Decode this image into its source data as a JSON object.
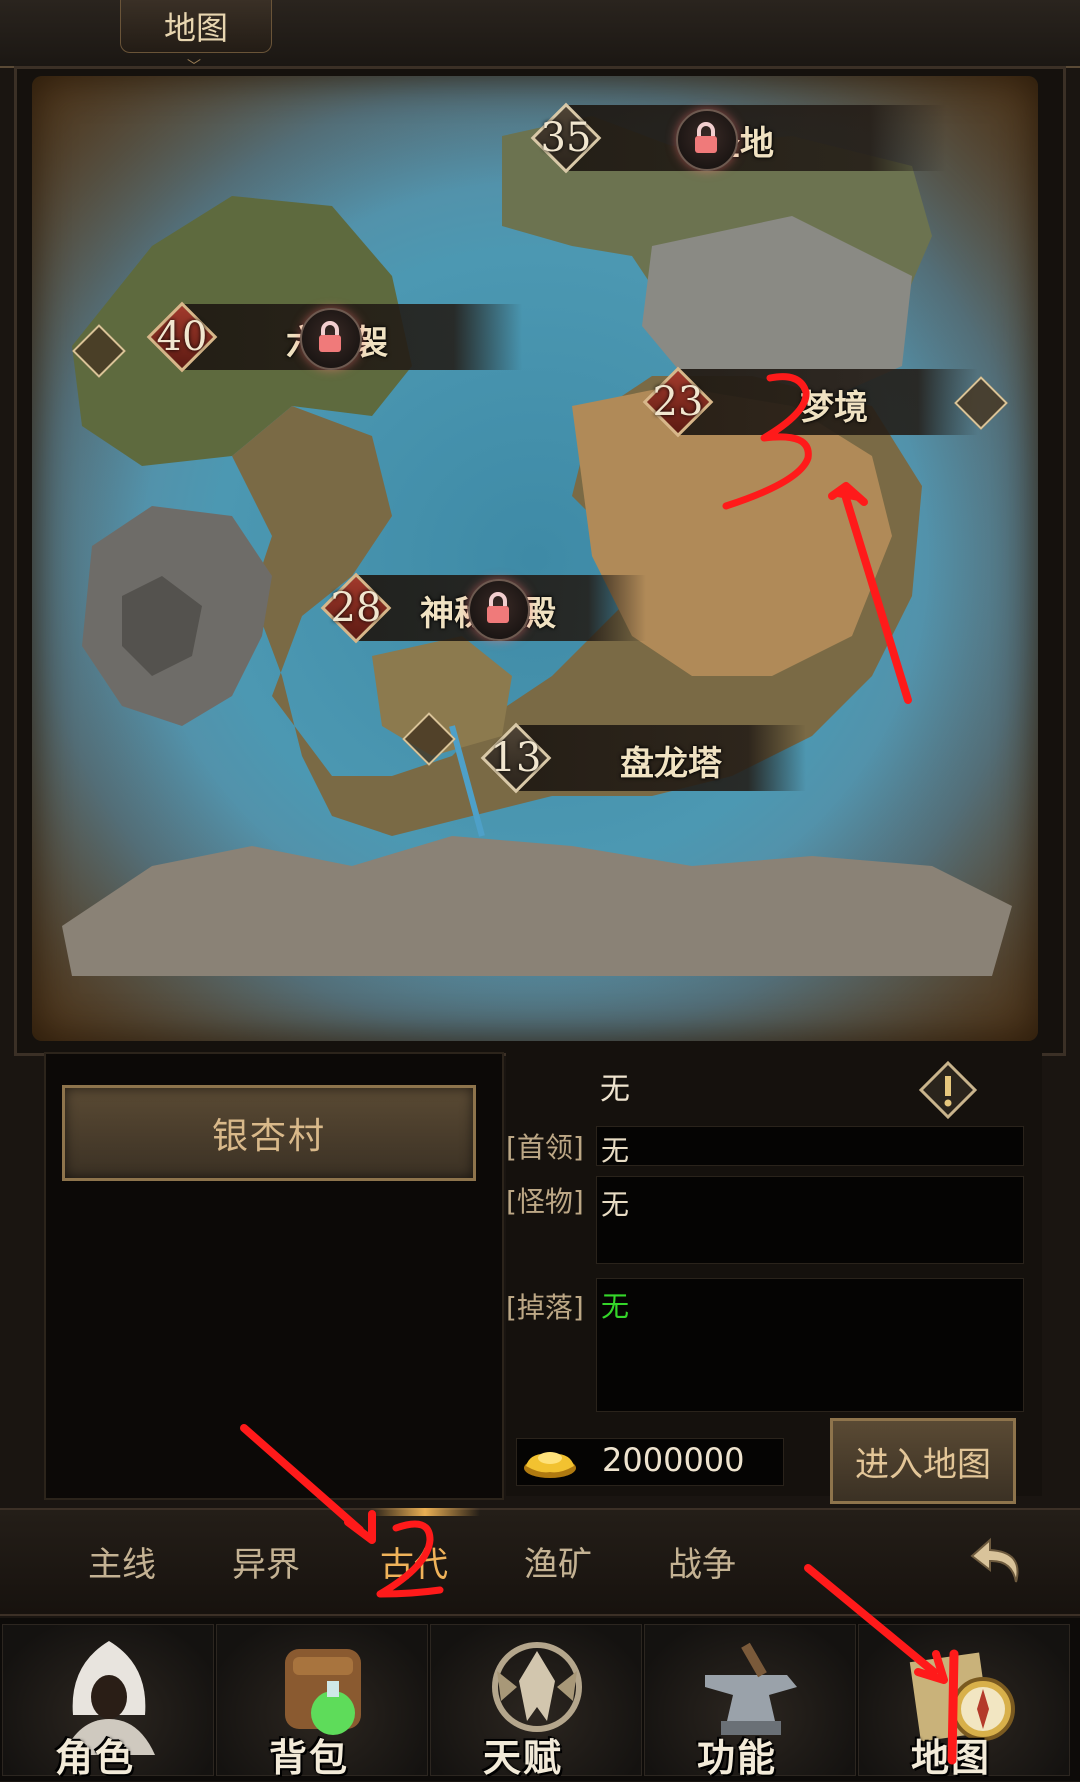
{
  "title": {
    "label": "地图"
  },
  "map": {
    "nodes": [
      {
        "level": "35",
        "name": "圣地",
        "locked": true
      },
      {
        "level": "40",
        "name": "六道袈",
        "locked": true
      },
      {
        "level": "23",
        "name": "梦境",
        "locked": false
      },
      {
        "level": "28",
        "name": "神秘暗殿",
        "locked": true
      },
      {
        "level": "13",
        "name": "盘龙塔",
        "locked": false
      }
    ]
  },
  "panel": {
    "selected_village": "银杏村",
    "map_name": "无",
    "fields": [
      {
        "label": "[首领]",
        "value": "无"
      },
      {
        "label": "[怪物]",
        "value": "无"
      },
      {
        "label": "[掉落]",
        "value": "无"
      }
    ],
    "gold_amount": "2000000",
    "enter_button": "进入地图"
  },
  "tabs": [
    {
      "label": "主线",
      "active": false
    },
    {
      "label": "异界",
      "active": false
    },
    {
      "label": "古代",
      "active": true
    },
    {
      "label": "渔矿",
      "active": false
    },
    {
      "label": "战争",
      "active": false
    }
  ],
  "bottom_nav": [
    {
      "label": "角色",
      "icon": "hooded-figure-icon"
    },
    {
      "label": "背包",
      "icon": "backpack-icon"
    },
    {
      "label": "天赋",
      "icon": "dragon-emblem-icon"
    },
    {
      "label": "功能",
      "icon": "anvil-icon"
    },
    {
      "label": "地图",
      "icon": "map-compass-icon"
    }
  ],
  "colors": {
    "active_tab": "#f0b35a",
    "drop_value": "#35d62a",
    "annotation": "#ff1a1a"
  }
}
